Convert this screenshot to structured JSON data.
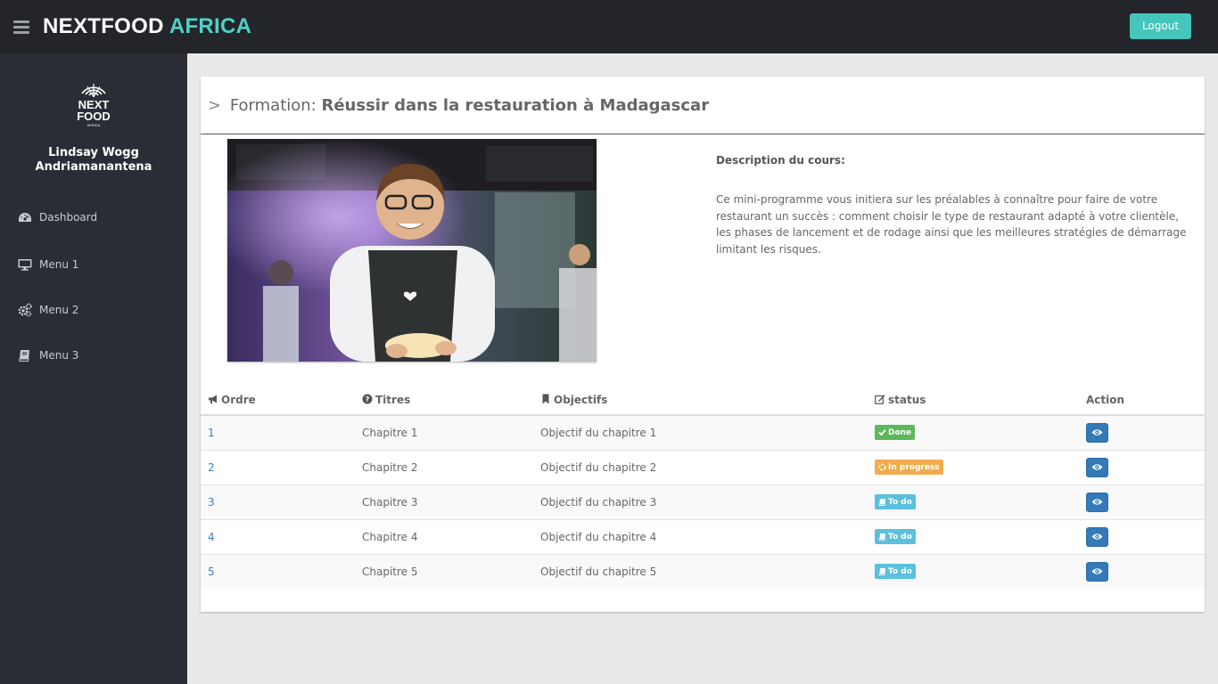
{
  "header": {
    "brand_primary": "NEXTFOOD",
    "brand_accent": "AFRICA",
    "logout_label": "Logout",
    "colors": {
      "bar": "#23252b",
      "accent": "#4dd3c6",
      "logout": "#45c5bb"
    }
  },
  "sidebar": {
    "logo": {
      "line1": "NEXT",
      "line2": "FOOD",
      "line3": "AFRICA"
    },
    "user": {
      "first": "Lindsay Wogg",
      "last": "Andriamanantena"
    },
    "items": [
      {
        "label": "Dashboard",
        "icon": "dashboard-icon"
      },
      {
        "label": "Menu 1",
        "icon": "desktop-icon"
      },
      {
        "label": "Menu 2",
        "icon": "gears-icon"
      },
      {
        "label": "Menu 3",
        "icon": "book-icon"
      }
    ]
  },
  "course": {
    "prefix": ">",
    "label": "Formation:",
    "title": "Réussir dans la restauration à Madagascar",
    "description_label": "Description du cours:",
    "description": "Ce mini-programme vous initiera sur les préalables à connaître pour faire de votre restaurant un succès : comment choisir le type de restaurant adapté à votre clientèle, les phases de lancement et de rodage ainsi que les meilleures stratégies de démarrage limitant les risques."
  },
  "table": {
    "headers": {
      "order": "Ordre",
      "titles": "Titres",
      "objectives": "Objectifs",
      "status": "status",
      "action": "Action"
    },
    "rows": [
      {
        "order": "1",
        "title": "Chapitre 1",
        "objective": "Objectif du chapitre 1",
        "status": "Done",
        "status_type": "done"
      },
      {
        "order": "2",
        "title": "Chapitre 2",
        "objective": "Objectif du chapitre 2",
        "status": "In progress",
        "status_type": "progress"
      },
      {
        "order": "3",
        "title": "Chapitre 3",
        "objective": "Objectif du chapitre 3",
        "status": "To do",
        "status_type": "todo"
      },
      {
        "order": "4",
        "title": "Chapitre 4",
        "objective": "Objectif du chapitre 4",
        "status": "To do",
        "status_type": "todo"
      },
      {
        "order": "5",
        "title": "Chapitre 5",
        "objective": "Objectif du chapitre 5",
        "status": "To do",
        "status_type": "todo"
      }
    ],
    "status_colors": {
      "done": "#5cb85c",
      "progress": "#f0ad4e",
      "todo": "#5bc0de"
    }
  }
}
